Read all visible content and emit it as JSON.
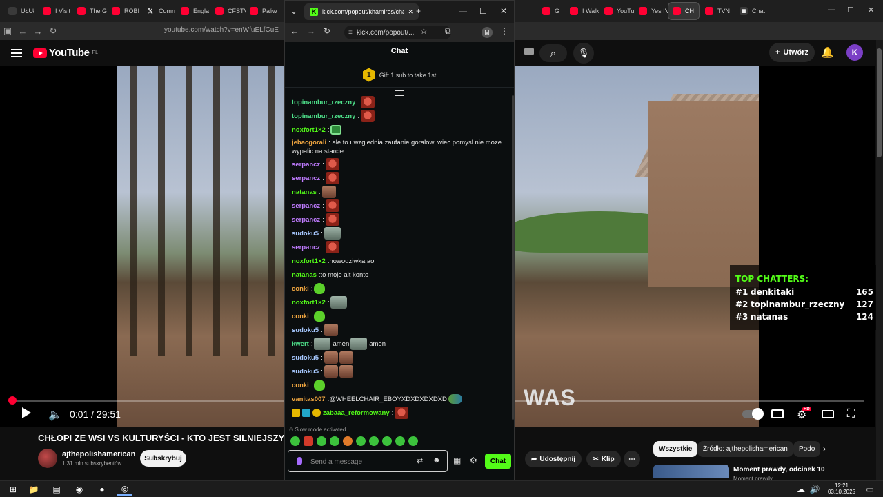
{
  "colors": {
    "kick_green": "#53fc18",
    "yt_red": "#ff0033"
  },
  "browser": {
    "tabs": [
      {
        "label": "UŁUł",
        "icon": "plain"
      },
      {
        "label": "I Visit",
        "icon": "yt"
      },
      {
        "label": "The G",
        "icon": "yt"
      },
      {
        "label": "ROBI",
        "icon": "yt"
      },
      {
        "label": "Comn",
        "icon": "x"
      },
      {
        "label": "Engla",
        "icon": "yt"
      },
      {
        "label": "CFSTV",
        "icon": "yt"
      },
      {
        "label": "Paliw",
        "icon": "yt"
      },
      {
        "label": "G",
        "icon": "yt"
      },
      {
        "label": "I Walk",
        "icon": "yt"
      },
      {
        "label": "YouTu",
        "icon": "yt"
      },
      {
        "label": "Yes I'v",
        "icon": "yt"
      },
      {
        "label": "CH",
        "icon": "yt",
        "active": true
      },
      {
        "label": "TVN",
        "icon": "yt"
      },
      {
        "label": "Chat",
        "icon": "grid"
      }
    ],
    "url": "youtube.com/watch?v=enWfuELfCuE"
  },
  "youtube": {
    "logo_text": "YouTube",
    "logo_country": "PL",
    "create_label": "Utwórz",
    "avatar_letter": "K",
    "video_caption": "WAS",
    "time_display": "0:01 / 29:51",
    "progress_fraction": 0.001,
    "hd_badge": "HD",
    "title": "CHŁOPI ZE WSI VS KULTURYŚCI - KTO JEST SILNIEJSZY",
    "channel_name": "ajthepolishamerican",
    "channel_subs": "1,31 mln subskrybentów",
    "subscribe_label": "Subskrybuj",
    "share_label": "Udostępnij",
    "clip_label": "Klip",
    "chips": [
      "Wszystkie",
      "Źródło: ajthepolishamerican",
      "Podo"
    ],
    "rec_title": "Moment prawdy, odcinek 10",
    "rec_sub": "Moment prawdy"
  },
  "top_chatters": {
    "title": "TOP CHATTERS:",
    "rows": [
      {
        "rank": "#1",
        "name": "denkitaki",
        "count": "165"
      },
      {
        "rank": "#2",
        "name": "topinambur_rzeczny",
        "count": "127"
      },
      {
        "rank": "#3",
        "name": "natanas",
        "count": "124"
      }
    ]
  },
  "popup": {
    "tab_title": "kick.com/popout/khamires/cha",
    "url": "kick.com/popout/...",
    "profile_letter": "M"
  },
  "chat": {
    "header": "Chat",
    "gift_badge": "1",
    "gift_text": "Gift 1 sub to take 1st",
    "slow_mode": "Slow mode activated",
    "placeholder": "Send a message",
    "send_label": "Chat",
    "messages": [
      {
        "user": "topinambur_rzeczny",
        "color": "#4ee08a",
        "text": "",
        "emotes": [
          "red"
        ]
      },
      {
        "user": "topinambur_rzeczny",
        "color": "#4ee08a",
        "text": "",
        "emotes": [
          "red"
        ]
      },
      {
        "user": "noxfort1×2",
        "color": "#53fc18",
        "text": "",
        "emotes": [
          "greenbox"
        ]
      },
      {
        "user": "jebacgorali",
        "color": "#f0a640",
        "text": "ale to uwzglednia zaufanie goralowi wiec pomysl nie moze wypalic na starcie",
        "emotes": [],
        "multi": true
      },
      {
        "user": "serpancz",
        "color": "#c07cff",
        "text": "",
        "emotes": [
          "red"
        ]
      },
      {
        "user": "serpancz",
        "color": "#c07cff",
        "text": "",
        "emotes": [
          "red"
        ]
      },
      {
        "user": "natanas",
        "color": "#53fc18",
        "text": "",
        "emotes": [
          "brown"
        ]
      },
      {
        "user": "serpancz",
        "color": "#c07cff",
        "text": "",
        "emotes": [
          "red"
        ]
      },
      {
        "user": "serpancz",
        "color": "#c07cff",
        "text": "",
        "emotes": [
          "red"
        ]
      },
      {
        "user": "sudoku5",
        "color": "#a7c8ff",
        "text": "",
        "emotes": [
          "face"
        ]
      },
      {
        "user": "serpancz",
        "color": "#c07cff",
        "text": "",
        "emotes": [
          "red"
        ]
      },
      {
        "user": "noxfort1×2",
        "color": "#53fc18",
        "text": "nowodziwka ao",
        "emotes": []
      },
      {
        "user": "natanas",
        "color": "#53fc18",
        "text": "to moje alt konto",
        "emotes": []
      },
      {
        "user": "conki",
        "color": "#f0a640",
        "text": "",
        "emotes": [
          "green"
        ]
      },
      {
        "user": "noxfort1×2",
        "color": "#53fc18",
        "text": "",
        "emotes": [
          "face"
        ]
      },
      {
        "user": "conki",
        "color": "#f0a640",
        "text": "",
        "emotes": [
          "green"
        ]
      },
      {
        "user": "sudoku5",
        "color": "#a7c8ff",
        "text": "",
        "emotes": [
          "brown"
        ]
      },
      {
        "user": "kwert",
        "color": "#4ee08a",
        "text": "",
        "emotes": [
          "face"
        ],
        "suffix": "amen",
        "emotes2": [
          "face"
        ],
        "suffix2": "amen"
      },
      {
        "user": "sudoku5",
        "color": "#a7c8ff",
        "text": "",
        "emotes": [
          "brown",
          "brown"
        ]
      },
      {
        "user": "sudoku5",
        "color": "#a7c8ff",
        "text": "",
        "emotes": [
          "brown",
          "brown"
        ]
      },
      {
        "user": "conki",
        "color": "#f0a640",
        "text": "",
        "emotes": [
          "green"
        ]
      },
      {
        "user": "vanitas007",
        "color": "#f0a640",
        "text": "@WHEELCHAIR_EBOYXDXDXDXDXD",
        "emotes": [
          "pepe"
        ]
      },
      {
        "user": "zabaaa_reformowany",
        "color": "#53fc18",
        "text": "",
        "emotes": [
          "red"
        ],
        "badges": [
          "badge-gold",
          "badge-blue",
          "badge-circle"
        ]
      }
    ]
  },
  "taskbar": {
    "time": "12:21",
    "date": "03.10.2025"
  }
}
